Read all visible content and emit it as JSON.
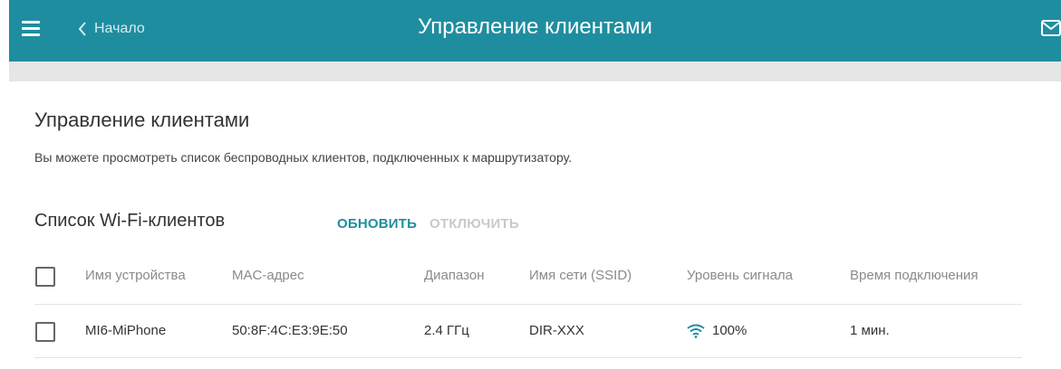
{
  "header": {
    "back_label": "Начало",
    "title": "Управление клиентами",
    "menu_icon": "hamburger-menu-icon",
    "back_icon": "chevron-left-icon",
    "mail_icon": "mail-icon"
  },
  "colors": {
    "header_bg": "#1f8da0",
    "accent": "#1f8da0",
    "disabled": "#c9c9c9",
    "subbar_bg": "#e6e6e6"
  },
  "main": {
    "section_title": "Управление клиентами",
    "description": "Вы можете просмотреть список беспроводных клиентов, подключенных к маршрутизатору.",
    "list_title": "Список Wi-Fi-клиентов",
    "refresh_label": "ОБНОВИТЬ",
    "disconnect_label": "ОТКЛЮЧИТЬ"
  },
  "table": {
    "columns": [
      "Имя устройства",
      "MAC-адрес",
      "Диапазон",
      "Имя сети (SSID)",
      "Уровень сигнала",
      "Время подключения"
    ],
    "rows": [
      {
        "name": "MI6-MiPhone",
        "mac": "50:8F:4C:E3:9E:50",
        "band": "2.4 ГГц",
        "ssid": "DIR-XXX",
        "signal_icon": "wifi-signal-icon",
        "signal": "100%",
        "time": "1 мин."
      }
    ]
  }
}
